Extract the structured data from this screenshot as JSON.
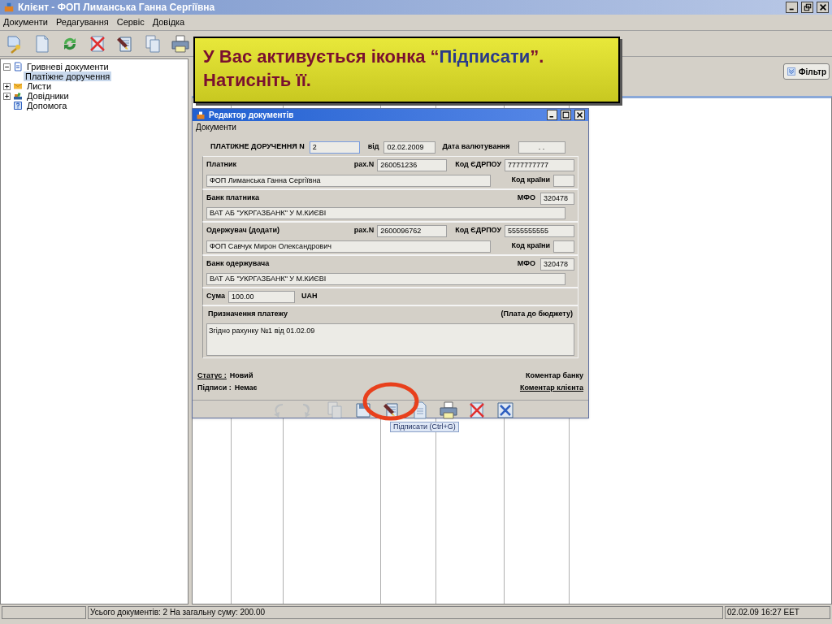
{
  "window": {
    "title": "Клієнт - ФОП Лиманська Ганна Сергіївна"
  },
  "menu": [
    "Документи",
    "Редагування",
    "Сервіс",
    "Довідка"
  ],
  "tree": [
    {
      "label": "Гривневі документи",
      "kind": "documents",
      "expanded": true,
      "selected": false,
      "children": [
        {
          "label": "Платіжне доручення",
          "selected": true
        }
      ]
    },
    {
      "label": "Листи",
      "kind": "letters",
      "expanded": false,
      "selected": false
    },
    {
      "label": "Довідники",
      "kind": "books",
      "expanded": false,
      "selected": false
    },
    {
      "label": "Допомога",
      "kind": "help",
      "selected": false
    }
  ],
  "filter_button": "Фільтр",
  "callout": {
    "before": "У Вас активується іконка “",
    "highlight": "Підписати",
    "after": "”.",
    "line2": "Натисніть її."
  },
  "dialog": {
    "title": "Редактор документів",
    "menu": [
      "Документи"
    ],
    "header": {
      "label": "ПЛАТІЖНЕ ДОРУЧЕННЯ N",
      "number": "2",
      "number_focused": true,
      "date_label": "від",
      "date": "02.02.2009",
      "value_date_label": "Дата валютування",
      "value_date": ". ."
    },
    "payer": {
      "label": "Платник",
      "account_label": "рах.N",
      "account": "260051236",
      "code_label": "Код ЄДРПОУ",
      "code": "7777777777",
      "name": "ФОП Лиманська Ганна Сергіївна",
      "country_label": "Код країни"
    },
    "payer_bank": {
      "label": "Банк платника",
      "mfo_label": "МФО",
      "mfo": "320478",
      "name": "ВАТ АБ \"УКРГАЗБАНК\" У М.КИЄВІ"
    },
    "recipient": {
      "label": "Одержувач  (додати)",
      "account_label": "рах.N",
      "account": "2600096762",
      "code_label": "Код ЄДРПОУ",
      "code": "5555555555",
      "name": "ФОП Савчук Мирон Олександрович",
      "country_label": "Код країни"
    },
    "recipient_bank": {
      "label": "Банк одержувача",
      "mfo_label": "МФО",
      "mfo": "320478",
      "name": "ВАТ АБ \"УКРГАЗБАНК\" У М.КИЄВІ"
    },
    "amount": {
      "label": "Сума",
      "value": "100.00",
      "currency": "UAH"
    },
    "purpose": {
      "label": "Призначення платежу",
      "note": "(Плата до бюджету)",
      "text": "Згідно рахунку №1 від 01.02.09"
    },
    "status": {
      "label": "Статус :",
      "value": "Новий"
    },
    "signatures": {
      "label": "Підписи :",
      "value": "Немає"
    },
    "links": [
      {
        "label": "Коментар банку",
        "underlined": false
      },
      {
        "label": "Коментар клієнта",
        "underlined": true
      }
    ],
    "toolbar": [
      {
        "kind": "undo",
        "disabled": true
      },
      {
        "kind": "redo",
        "disabled": true
      },
      {
        "kind": "copy",
        "disabled": true
      },
      {
        "kind": "save",
        "disabled": false
      },
      {
        "kind": "sign",
        "disabled": false,
        "highlighted": true
      },
      {
        "kind": "page",
        "disabled": false
      },
      {
        "kind": "print",
        "disabled": false
      },
      {
        "kind": "delete",
        "disabled": false
      },
      {
        "kind": "close",
        "disabled": false
      }
    ],
    "tooltip": "Підписати (Ctrl+G)"
  },
  "status_bar": {
    "summary": "Усього документів: 2 На загальну суму: 200.00",
    "datetime": "02.02.09 16:27 EET"
  }
}
